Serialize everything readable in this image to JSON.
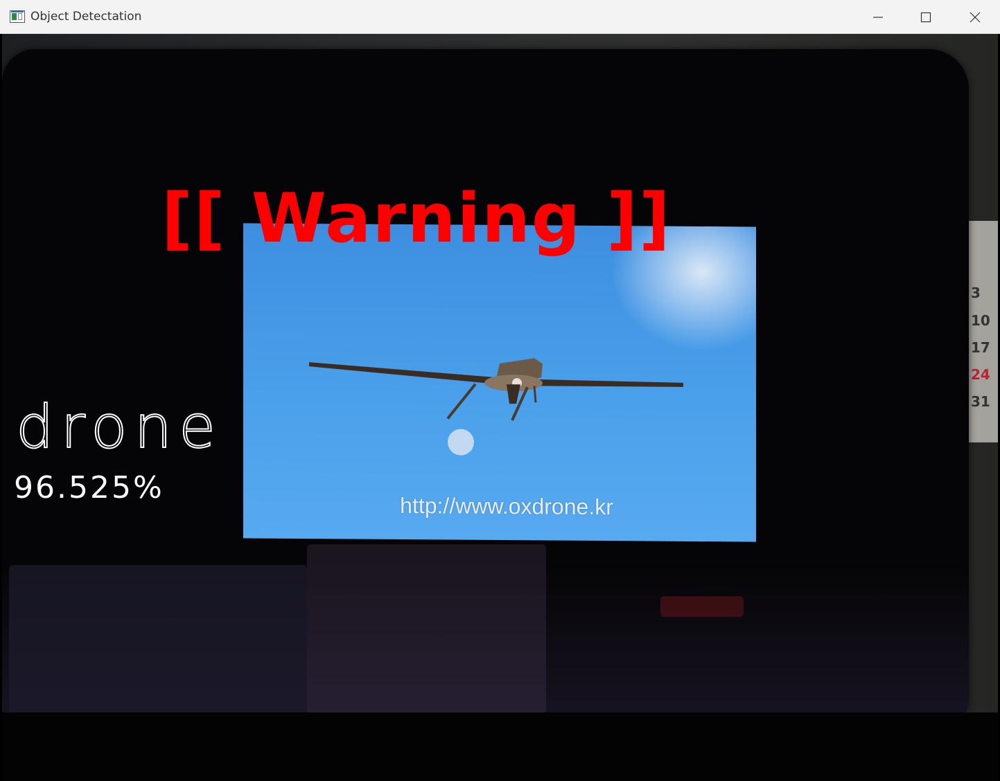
{
  "window": {
    "title": "Object Detectation",
    "controls": [
      "minimize-icon",
      "maximize-icon",
      "close-icon"
    ]
  },
  "overlay": {
    "warning": "[[ Warning ]]",
    "warning_color": "#ff0000",
    "label": "drone",
    "confidence": "96.525%",
    "text_color": "#ffffff"
  },
  "scene": {
    "photo_url_text": "http://www.oxdrone.kr",
    "calendar_numbers": [
      {
        "value": "3",
        "color": "#333333"
      },
      {
        "value": "10",
        "color": "#333333"
      },
      {
        "value": "17",
        "color": "#333333"
      },
      {
        "value": "24",
        "color": "#bb2233"
      },
      {
        "value": "31",
        "color": "#333333"
      }
    ]
  }
}
